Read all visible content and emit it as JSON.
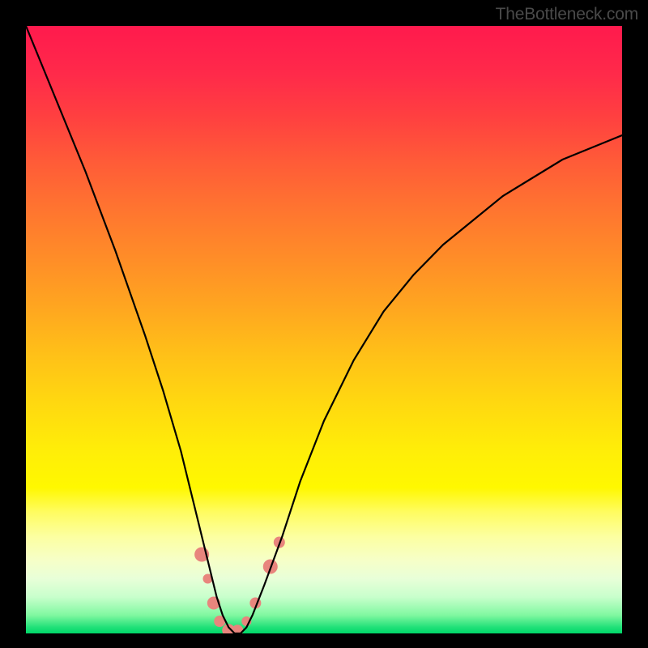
{
  "watermark": "TheBottleneck.com",
  "chart_data": {
    "type": "line",
    "title": "",
    "xlabel": "",
    "ylabel": "",
    "xlim": [
      0,
      100
    ],
    "ylim": [
      0,
      100
    ],
    "grid": false,
    "legend": false,
    "series": [
      {
        "name": "bottleneck-curve",
        "color": "#000000",
        "x": [
          0,
          5,
          10,
          15,
          20,
          23,
          26,
          28,
          30,
          31,
          32,
          33,
          34,
          35,
          36,
          37,
          38,
          40,
          43,
          46,
          50,
          55,
          60,
          65,
          70,
          75,
          80,
          85,
          90,
          95,
          100
        ],
        "y": [
          100,
          88,
          76,
          63,
          49,
          40,
          30,
          22,
          14,
          10,
          6,
          3,
          1,
          0,
          0,
          1,
          3,
          8,
          16,
          25,
          35,
          45,
          53,
          59,
          64,
          68,
          72,
          75,
          78,
          80,
          82
        ]
      }
    ],
    "markers": [
      {
        "x": 29.5,
        "y": 13,
        "r": 9
      },
      {
        "x": 30.5,
        "y": 9,
        "r": 6
      },
      {
        "x": 31.5,
        "y": 5,
        "r": 8
      },
      {
        "x": 32.5,
        "y": 2,
        "r": 7
      },
      {
        "x": 34,
        "y": 0.5,
        "r": 8
      },
      {
        "x": 35.5,
        "y": 0.5,
        "r": 7
      },
      {
        "x": 37,
        "y": 2,
        "r": 6
      },
      {
        "x": 38.5,
        "y": 5,
        "r": 7
      },
      {
        "x": 41,
        "y": 11,
        "r": 9
      },
      {
        "x": 42.5,
        "y": 15,
        "r": 7
      }
    ],
    "marker_color": "#e8857d",
    "background": "rainbow-gradient-vertical",
    "description": "V-shaped bottleneck curve on red-to-green vertical gradient; salmon markers near valley minimum."
  }
}
